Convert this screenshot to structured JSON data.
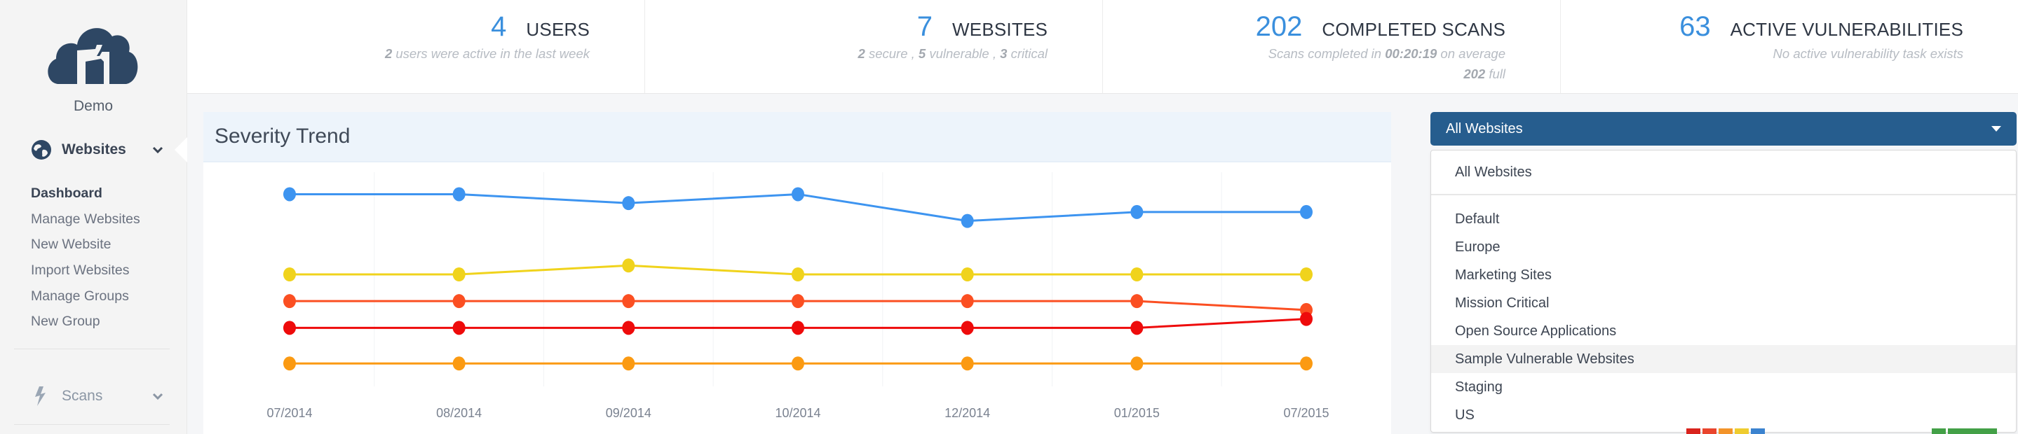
{
  "sidebar": {
    "org_name": "Demo",
    "sections": [
      {
        "label": "Websites",
        "icon": "globe-icon",
        "expanded": true
      },
      {
        "label": "Scans",
        "icon": "lightning-icon",
        "expanded": false
      }
    ],
    "website_items": [
      {
        "label": "Dashboard",
        "active": true
      },
      {
        "label": "Manage Websites",
        "active": false
      },
      {
        "label": "New Website",
        "active": false
      },
      {
        "label": "Import Websites",
        "active": false
      },
      {
        "label": "Manage Groups",
        "active": false
      },
      {
        "label": "New Group",
        "active": false
      }
    ]
  },
  "stats": [
    {
      "value": "4",
      "title": "USERS",
      "sub_parts": [
        {
          "b": "2"
        },
        {
          "t": " users were active in the last week"
        }
      ]
    },
    {
      "value": "7",
      "title": "WEBSITES",
      "sub_parts": [
        {
          "b": "2"
        },
        {
          "t": " secure , "
        },
        {
          "b": "5"
        },
        {
          "t": " vulnerable , "
        },
        {
          "b": "3"
        },
        {
          "t": " critical"
        }
      ]
    },
    {
      "value": "202",
      "title": "COMPLETED SCANS",
      "sub_parts": [
        {
          "t": "Scans completed in "
        },
        {
          "b": "00:20:19"
        },
        {
          "t": " on average"
        }
      ],
      "sub_parts2": [
        {
          "b": "202"
        },
        {
          "t": " full"
        }
      ]
    },
    {
      "value": "63",
      "title": "ACTIVE VULNERABILITIES",
      "sub_parts": [
        {
          "t": "No active vulnerability task exists"
        }
      ]
    }
  ],
  "chart_panel": {
    "title": "Severity Trend"
  },
  "chart_data": {
    "type": "line",
    "title": "Severity Trend",
    "xlabel": "",
    "ylabel": "",
    "categories": [
      "07/2014",
      "08/2014",
      "09/2014",
      "10/2014",
      "12/2014",
      "01/2015",
      "07/2015"
    ],
    "ylim": [
      0,
      22
    ],
    "grid": "vertical",
    "legend": "none",
    "series": [
      {
        "name": "blue",
        "color": "#3d94f0",
        "values": [
          20,
          20,
          19,
          20,
          17,
          18,
          18
        ]
      },
      {
        "name": "yellow",
        "color": "#f0d31c",
        "values": [
          11,
          11,
          12,
          11,
          11,
          11,
          11
        ]
      },
      {
        "name": "orange-red",
        "color": "#fb4f22",
        "values": [
          8,
          8,
          8,
          8,
          8,
          8,
          7
        ]
      },
      {
        "name": "red",
        "color": "#ee0b0b",
        "values": [
          5,
          5,
          5,
          5,
          5,
          5,
          6
        ]
      },
      {
        "name": "orange",
        "color": "#fb9a12",
        "values": [
          1,
          1,
          1,
          1,
          1,
          1,
          1
        ]
      }
    ]
  },
  "dropdown": {
    "selected": "All Websites",
    "options": [
      "All Websites",
      "Default",
      "Europe",
      "Marketing Sites",
      "Mission Critical",
      "Open Source Applications",
      "Sample Vulnerable Websites",
      "Staging",
      "US"
    ],
    "hovered": "Sample Vulnerable Websites"
  },
  "peek_badges": {
    "colors": [
      "#d9231d",
      "#e9452d",
      "#f3942a",
      "#efcc2f",
      "#3b83cf"
    ],
    "right_colors": [
      "#43a047",
      "#43a047"
    ]
  }
}
